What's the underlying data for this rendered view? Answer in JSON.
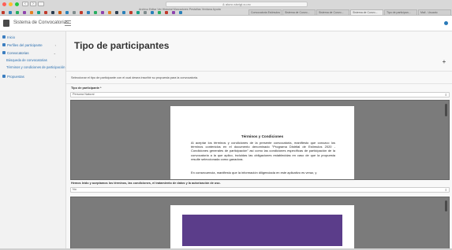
{
  "browser": {
    "url": "& aluno.sisrigt.cu.ec",
    "menu_text": "Archivo  Editar  Ver  Historial  Marcadores  Pestañas  Ventana  Ayuda",
    "tabs": [
      {
        "label": "Convocatoria Estímulos",
        "active": false
      },
      {
        "label": "Sistema de Convo...",
        "active": false
      },
      {
        "label": "Sistema de Convo...",
        "active": false
      },
      {
        "label": "Sistema de Convo...",
        "active": true
      },
      {
        "label": "Tipo de participan...",
        "active": false
      },
      {
        "label": "Mail - Usuario",
        "active": false
      }
    ],
    "bookmark_colors": [
      "#c0392b",
      "#2980b9",
      "#27ae60",
      "#8e44ad",
      "#e67e22",
      "#16a085",
      "#c0392b",
      "#2c3e50",
      "#d35400",
      "#2980b9",
      "#7f8c8d",
      "#c0392b",
      "#2980b9",
      "#27ae60",
      "#8e44ad",
      "#e67e22",
      "#2c3e50",
      "#2980b9",
      "#c0392b",
      "#16a085",
      "#7f8c8d",
      "#2980b9",
      "#27ae60",
      "#c0392b",
      "#8e44ad",
      "#2980b9"
    ]
  },
  "app": {
    "title": "Sistema de Convocatorias",
    "accent": "#2a6fb0"
  },
  "sidebar": {
    "items": [
      {
        "label": "Inicio",
        "icon": "home-icon",
        "has_chevron": false
      },
      {
        "label": "Perfiles del participante",
        "icon": "user-icon",
        "has_chevron": true
      },
      {
        "label": "Convocatorias",
        "icon": "megaphone-icon",
        "has_chevron": true
      }
    ],
    "subitems": [
      {
        "label": "Búsqueda de convocatorias"
      },
      {
        "label": "Términos y condiciones de participación"
      }
    ],
    "last_item": {
      "label": "Propuestas",
      "icon": "gear-icon",
      "has_chevron": true
    }
  },
  "main": {
    "page_title": "Tipo de participantes",
    "plus_label": "+",
    "instructions": "Seleccionar el tipo de participante con el cual desea inscribir su propuesta para la convocatoria.",
    "type_field": {
      "label": "Tipo de participante *",
      "value": "Persona Natural"
    },
    "document": {
      "title": "Términos y Condiciones",
      "paragraph1": "Al aceptar los términos y condiciones de la presente convocatoria, manifiesto que conozco los términos contenidos en el documento denominado \"Programa Distrital de Estímulos 2020 - Condiciones generales de participación\" así como las condiciones específicas de participación de la convocatoria a la que aplico, incluidas las obligaciones establecidas en caso de que la propuesta resulte seleccionada como ganadora.",
      "paragraph2": "En consecuencia, manifiesto que la información diligenciada en este aplicativo es veraz, y"
    },
    "accept_field": {
      "label": "Hemos leído y aceptamos los términos, las condiciones, el tratamiento de datos y la autorización de uso.",
      "value": "No"
    }
  }
}
